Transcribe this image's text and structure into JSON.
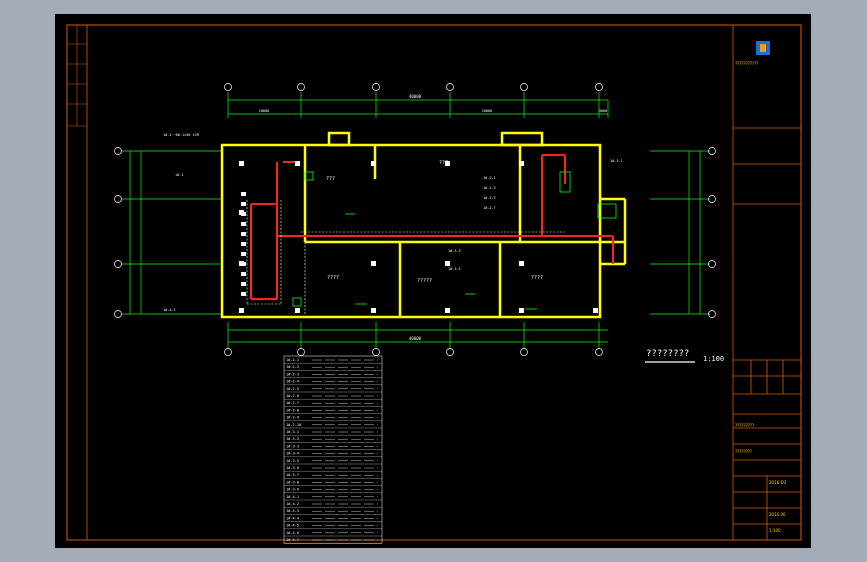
{
  "colors": {
    "background": "#a4acb9",
    "sheet": "#000000",
    "frame": "#d65c00",
    "wall": "#ffff00",
    "pipe": "#ff2020",
    "dim": "#00ff00",
    "text": "#ffffff",
    "grid": "#ffffff",
    "titlebar": "#ffd000"
  },
  "scale_caption": "????????",
  "scale_value": "1:100",
  "dims_top": {
    "total": "40000",
    "sub_left": "18000",
    "sub_mid": "18000",
    "sub_right": "4000"
  },
  "dims_bottom": {
    "total": "40000"
  },
  "rooms": {
    "room_a": "???",
    "room_b": "???",
    "room_c": "????",
    "room_d": "?????",
    "room_e": "????"
  },
  "legend_rows": [
    "1#-2-1",
    "1#-2-2",
    "1#-2-3",
    "1#-2-4",
    "1#-2-5",
    "1#-2-6",
    "1#-2-7",
    "1#-2-8",
    "1#-2-9",
    "1#-2-10",
    "1#-3-1",
    "1#-3-2",
    "1#-3-3",
    "1#-3-4",
    "1#-3-5",
    "1#-3-6",
    "1#-3-7",
    "1#-3-8",
    "1#-3-9",
    "1#-4-1",
    "1#-4-2",
    "1#-4-3",
    "1#-4-4",
    "1#-4-5",
    "1#-4-6",
    "1#-4-7"
  ],
  "title_block": {
    "company": "???????????",
    "project": "?????????",
    "drawing_name": "????????",
    "drawing_no": "2016-D3",
    "date": "2016.06",
    "scale": "1:100"
  }
}
